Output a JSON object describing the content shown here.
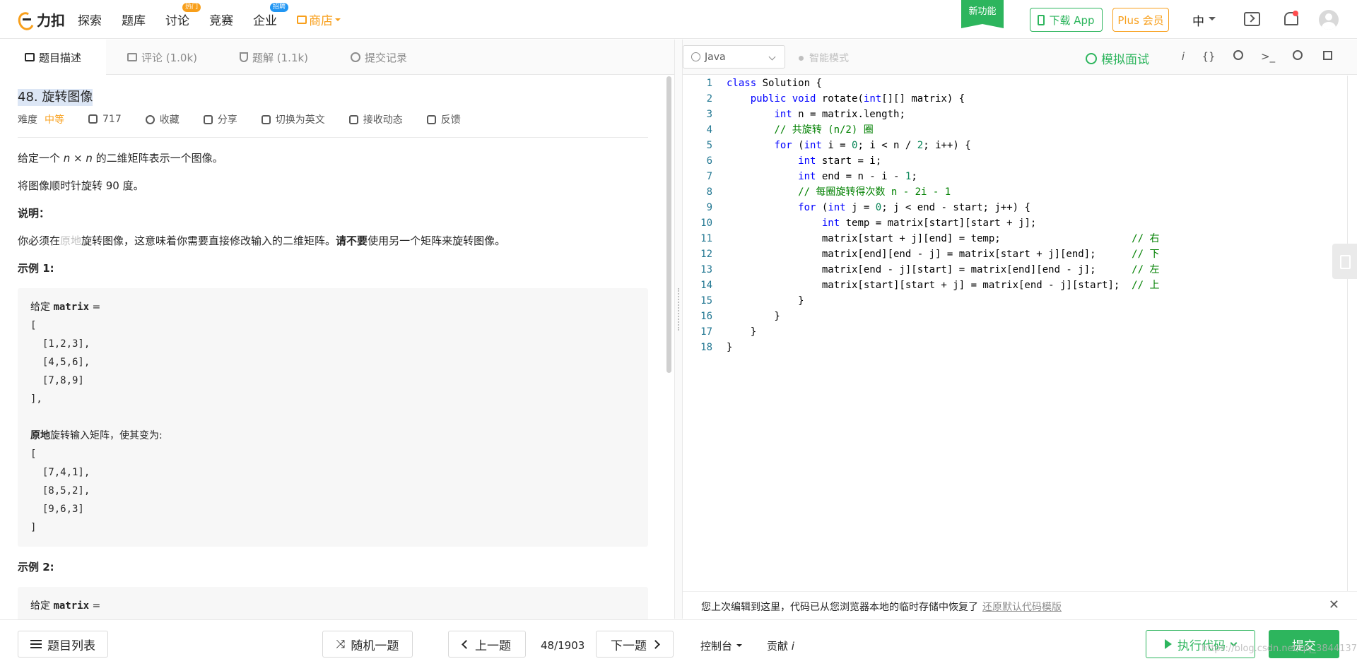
{
  "nav": {
    "logo_text": "力扣",
    "items": [
      {
        "label": "探索"
      },
      {
        "label": "题库"
      },
      {
        "label": "讨论",
        "badge": "热门"
      },
      {
        "label": "竞赛"
      },
      {
        "label": "企业",
        "badge": "招聘"
      }
    ],
    "shop_label": "商店",
    "new_feature": "新功能",
    "download_app": "下载 App",
    "plus": "Plus 会员",
    "language": "中"
  },
  "left_tabs": [
    {
      "label": "题目描述"
    },
    {
      "label": "评论 (1.0k)"
    },
    {
      "label": "题解 (1.1k)"
    },
    {
      "label": "提交记录"
    }
  ],
  "problem": {
    "title": "48. 旋转图像",
    "difficulty_label": "难度",
    "difficulty": "中等",
    "likes": "717",
    "actions": [
      "收藏",
      "分享",
      "切换为英文",
      "接收动态",
      "反馈"
    ],
    "p1_prefix": "给定一个 ",
    "p1_var": "n × n",
    "p1_suffix": " 的二维矩阵表示一个图像。",
    "p2": "将图像顺时针旋转 90 度。",
    "note_heading": "说明：",
    "p3_a": "你必须在",
    "p3_b": "原地",
    "p3_c": "旋转图像，这意味着你需要直接修改输入的二维矩阵。",
    "p3_d": "请不要",
    "p3_e": "使用另一个矩阵来旋转图像。",
    "ex1_heading": "示例 1:",
    "ex1_given": "给定 ",
    "ex1_var": "matrix",
    "ex1_eq": " =",
    "ex1_input": [
      "[",
      "  [1,2,3],",
      "  [4,5,6],",
      "  [7,8,9]",
      "],"
    ],
    "ex1_rot_b": "原地",
    "ex1_rot_rest": "旋转输入矩阵，使其变为:",
    "ex1_output": [
      "[",
      "  [7,4,1],",
      "  [8,5,2],",
      "  [9,6,3]",
      "]"
    ],
    "ex2_heading": "示例 2:",
    "ex2_given": "给定 ",
    "ex2_var": "matrix",
    "ex2_eq": " ="
  },
  "editor": {
    "language": "Java",
    "smart_mode": "智能模式",
    "mock_interview": "模拟面试",
    "lines": [
      "class Solution {",
      "    public void rotate(int[][] matrix) {",
      "        int n = matrix.length;",
      "        // 共旋转 (n/2) 圈",
      "        for (int i = 0; i < n / 2; i++) {",
      "            int start = i;",
      "            int end = n - i - 1;",
      "            // 每圈旋转得次数 n - 2i - 1",
      "            for (int j = 0; j < end - start; j++) {",
      "                int temp = matrix[start][start + j];",
      "                matrix[start + j][end] = temp;                      // 右",
      "                matrix[end][end - j] = matrix[start + j][end];      // 下",
      "                matrix[end - j][start] = matrix[end][end - j];      // 左",
      "                matrix[start][start + j] = matrix[end - j][start];  // 上",
      "            }",
      "        }",
      "    }",
      "}"
    ],
    "restore_text": "您上次编辑到这里，代码已从您浏览器本地的临时存储中恢复了",
    "restore_link": "还原默认代码模版"
  },
  "bottom": {
    "problem_list": "题目列表",
    "random": "随机一题",
    "prev": "上一题",
    "page": "48/1903",
    "next": "下一题",
    "console": "控制台",
    "contribute": "贡献 ",
    "contribute_i": "i",
    "run": "执行代码",
    "submit": "提交",
    "watermark": "https://blog.csdn.net/qq_38441377"
  },
  "colors": {
    "accent": "#2db55d",
    "orange": "#f89f1b"
  }
}
